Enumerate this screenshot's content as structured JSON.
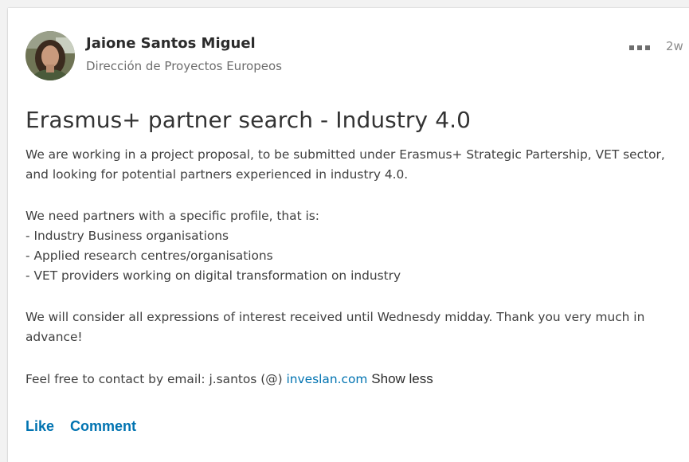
{
  "post": {
    "author": {
      "name": "Jaione Santos Miguel",
      "headline": "Dirección de Proyectos Europeos"
    },
    "timestamp": "2w",
    "title": "Erasmus+ partner search - Industry 4.0",
    "body": {
      "p1_line1": "We are working in a project proposal, to be submitted under Erasmus+ Strategic Partership, VET sector,",
      "p1_line2": "and looking for potential partners experienced in industry 4.0.",
      "p2_intro": "We need partners with a specific profile, that is:",
      "p2_item1": "- Industry Business organisations",
      "p2_item2": "- Applied research centres/organisations",
      "p2_item3": "- VET providers working on digital transformation on industry",
      "p3_line1": "We will consider all expressions of interest received until Wednesdy midday. Thank you very much in",
      "p3_line2": "advance!",
      "contact_prefix": "Feel free to contact by email: j.santos (@) ",
      "contact_link": "inveslan.com",
      "show_less": "Show less"
    },
    "actions": {
      "like": "Like",
      "comment": "Comment"
    }
  },
  "colors": {
    "link": "#0073b1",
    "text": "#404040",
    "muted": "#6e6e6e"
  },
  "icons": {
    "menu": "more-horizontal-icon"
  }
}
